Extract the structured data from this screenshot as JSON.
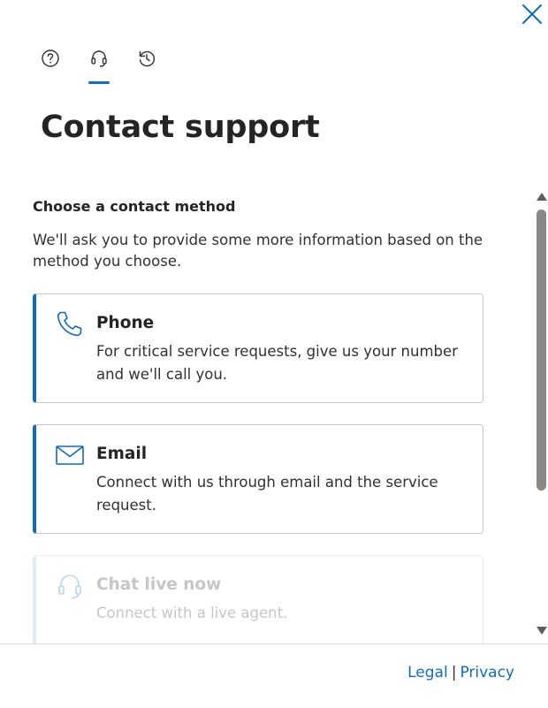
{
  "header": {
    "close_icon": "close-icon"
  },
  "tabs": [
    {
      "name": "help",
      "icon": "question-circle-icon"
    },
    {
      "name": "contact-support",
      "icon": "headset-icon",
      "selected": true
    },
    {
      "name": "history",
      "icon": "history-icon"
    }
  ],
  "page": {
    "title": "Contact support"
  },
  "contact": {
    "heading": "Choose a contact method",
    "description": "We'll ask you to provide some more information based on the method you choose.",
    "methods": [
      {
        "title": "Phone",
        "description": "For critical service requests, give us your number and we'll call you.",
        "icon": "phone-icon",
        "enabled": true
      },
      {
        "title": "Email",
        "description": "Connect with us through email and the service request.",
        "icon": "mail-icon",
        "enabled": true
      },
      {
        "title": "Chat live now",
        "description": "Connect with a live agent.",
        "icon": "headset-icon",
        "enabled": false
      }
    ]
  },
  "footer": {
    "legal": "Legal",
    "separator": "|",
    "privacy": "Privacy"
  },
  "colors": {
    "accent": "#0f6cbd",
    "text": "#242424",
    "disabled": "#c8c6c4"
  }
}
